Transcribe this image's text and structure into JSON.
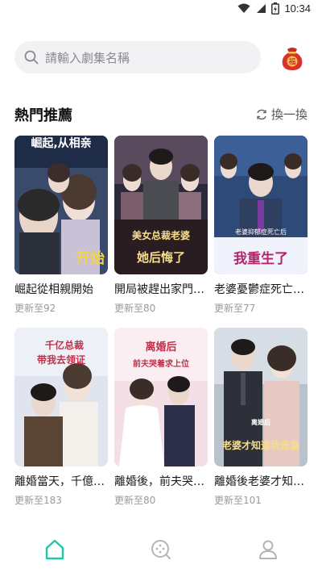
{
  "status_bar": {
    "time": "10:34"
  },
  "search": {
    "placeholder": "請輸入劇集名稱"
  },
  "gift": {
    "char": "福"
  },
  "section": {
    "title": "熱門推薦",
    "refresh_label": "換一換"
  },
  "dramas": [
    {
      "title": "崛起從相親開始",
      "episodes": "更新至92",
      "poster_text": [
        "崛起,从相亲",
        "开始"
      ]
    },
    {
      "title": "開局被趕出家門…",
      "episodes": "更新至80",
      "poster_text": [
        "美女总裁老婆",
        "她后悔了"
      ]
    },
    {
      "title": "老婆憂鬱症死亡…",
      "episodes": "更新至77",
      "poster_text": [
        "老婆抑郁症死亡后",
        "我重生了"
      ]
    },
    {
      "title": "離婚當天，千億…",
      "episodes": "更新至183",
      "poster_text": [
        "千亿总裁",
        "带我去领证"
      ]
    },
    {
      "title": "離婚後，前夫哭…",
      "episodes": "更新至80",
      "poster_text": [
        "离婚后",
        "前夫哭着求上位"
      ]
    },
    {
      "title": "離婚後老婆才知…",
      "episodes": "更新至101",
      "poster_text": [
        "离婚后",
        "老婆才知道我是皇"
      ]
    }
  ],
  "nav": [
    {
      "icon": "home-icon",
      "active": true
    },
    {
      "icon": "discover-icon",
      "active": false
    },
    {
      "icon": "profile-icon",
      "active": false
    }
  ],
  "colors": {
    "accent": "#1fc8a8",
    "gift_red": "#d9322b",
    "inactive": "#b5b5b5"
  }
}
